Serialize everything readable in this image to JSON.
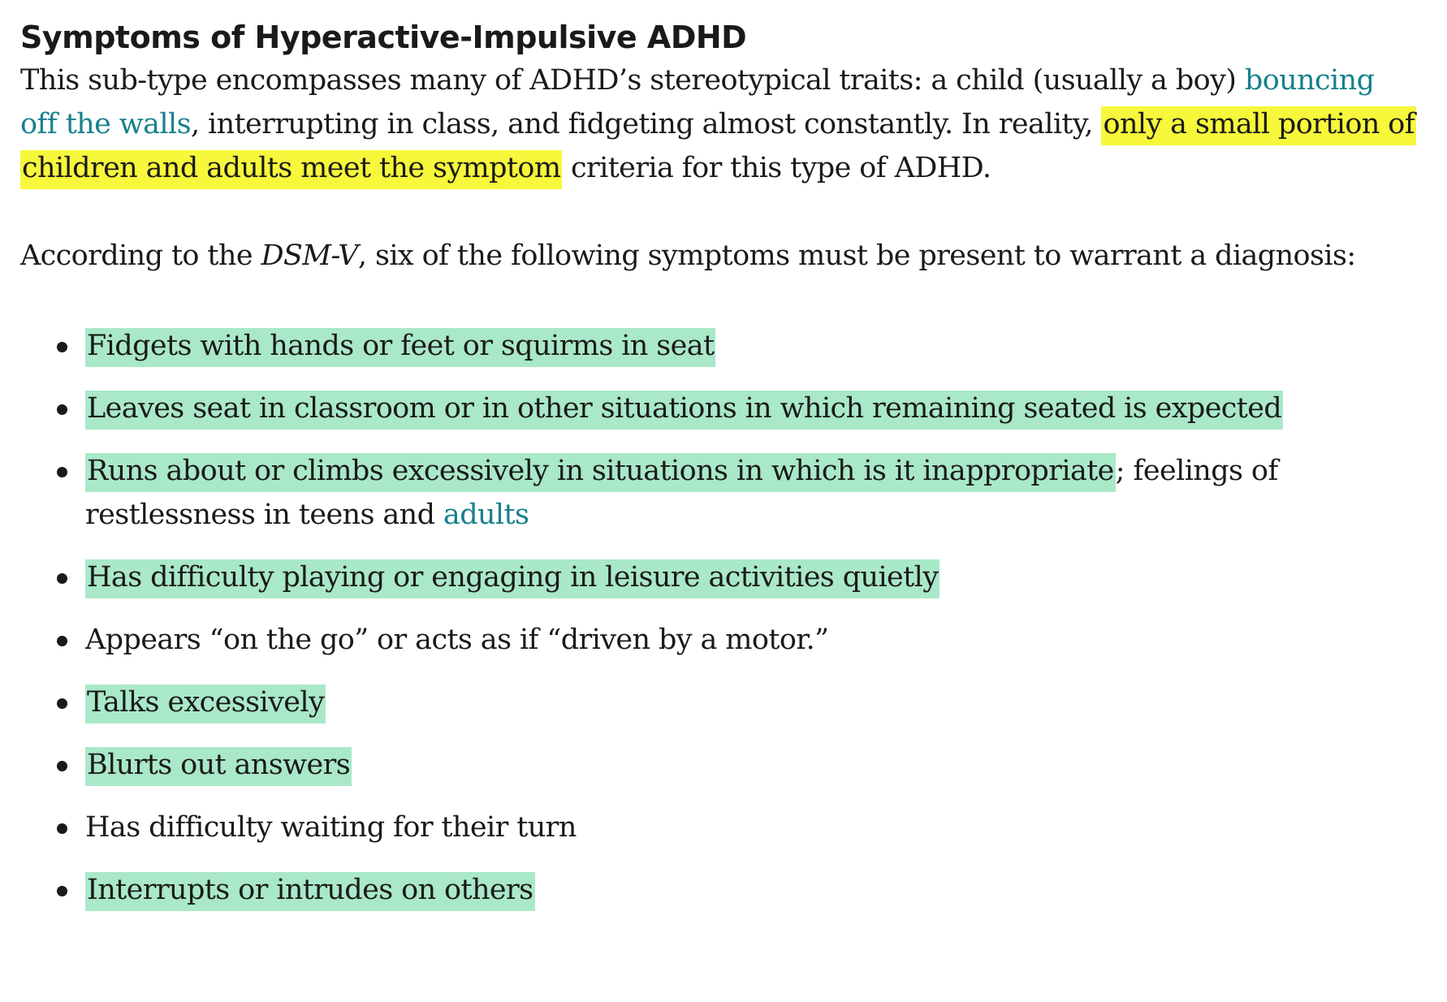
{
  "heading": "Symptoms of Hyperactive-Impulsive ADHD",
  "intro": {
    "part1": "This sub-type encompasses many of ADHD’s stereotypical traits: a child (usually a boy) ",
    "link": "bouncing off the walls",
    "part2": ", interrupting in class, and fidgeting almost constantly. In reality, ",
    "highlight": "only a small portion of children and adults meet the symptom",
    "part3": " criteria for this type of ADHD."
  },
  "criteria": {
    "part1": "According to the ",
    "manual": "DSM-V",
    "part2": ", six of the following symptoms must be present to warrant a diagnosis:"
  },
  "symptoms": [
    {
      "text": "Fidgets with hands or feet or squirms in seat",
      "highlighted": true
    },
    {
      "text": "Leaves seat in classroom or in other situations in which remaining seated is expected",
      "highlighted": true
    },
    {
      "text": "Runs about or climbs excessively in situations in which is it inappropriate",
      "highlighted": true,
      "rest": "; feelings of restlessness in teens and ",
      "link": "adults"
    },
    {
      "text": "Has difficulty playing or engaging in leisure activities quietly",
      "highlighted": true
    },
    {
      "text": "Appears “on the go” or acts as if “driven by a motor.”",
      "highlighted": false
    },
    {
      "text": "Talks excessively",
      "highlighted": true
    },
    {
      "text": "Blurts out answers",
      "highlighted": true
    },
    {
      "text": "Has difficulty waiting for their turn",
      "highlighted": false
    },
    {
      "text": "Interrupts or intrudes on others",
      "highlighted": true
    }
  ],
  "colors": {
    "text": "#1a1a1a",
    "link": "#17808c",
    "highlight_yellow": "#f7f73b",
    "highlight_green": "#a9e8c8"
  }
}
